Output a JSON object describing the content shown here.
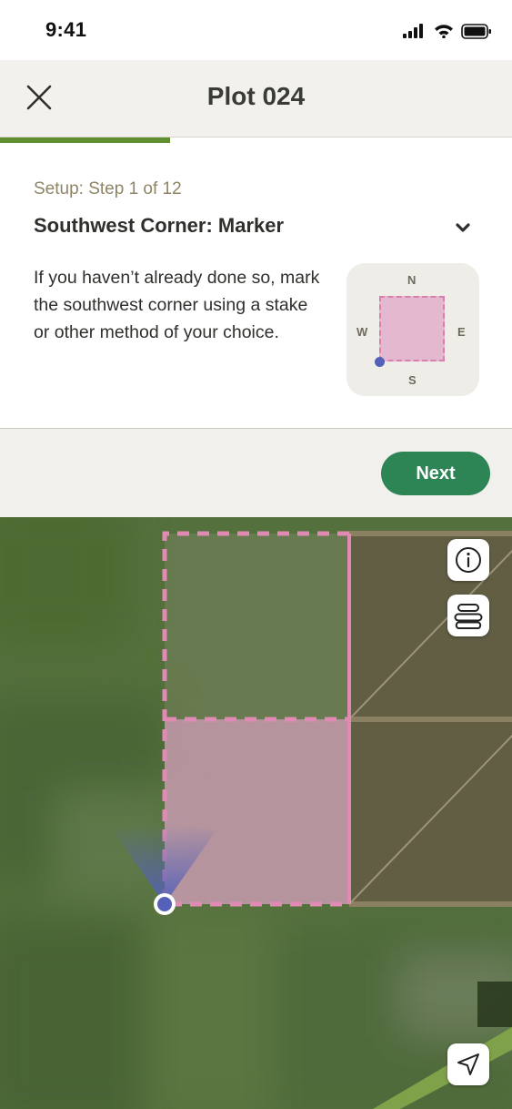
{
  "status_bar": {
    "time": "9:41"
  },
  "header": {
    "title": "Plot 024",
    "progress_fraction": 0.333
  },
  "step": {
    "label": "Setup: Step 1 of 12",
    "heading": "Southwest Corner: Marker",
    "description": "If you haven’t already done so, mark the southwest corner using a stake or other method of your choice.",
    "compass": {
      "north": "N",
      "south": "S",
      "east": "E",
      "west": "W"
    }
  },
  "actions": {
    "next_label": "Next"
  },
  "map": {
    "buttons": [
      "info-icon",
      "layers-icon",
      "location-arrow-icon"
    ],
    "colors": {
      "plot_outline": "#e08ab5",
      "user_location": "#5561b8",
      "active_button": "#2d8555",
      "progress": "#5f8f2e"
    }
  }
}
